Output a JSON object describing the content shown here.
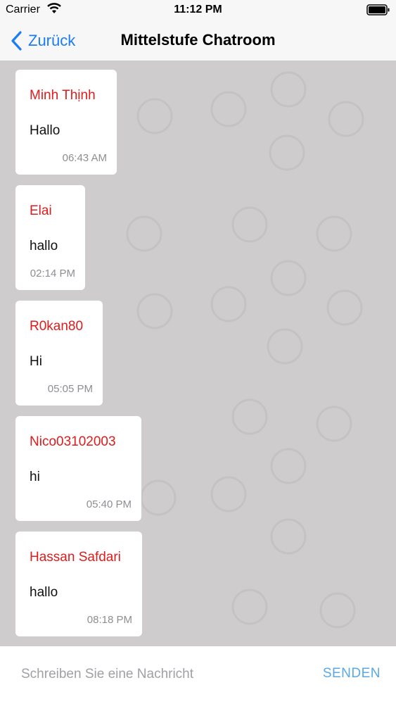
{
  "status_bar": {
    "carrier": "Carrier",
    "time": "11:12 PM",
    "wifi_icon": "wifi-icon",
    "battery_icon": "battery-icon"
  },
  "nav": {
    "back_label": "Zurück",
    "title": "Mittelstufe Chatroom",
    "accent_color": "#1a7cf6"
  },
  "messages": [
    {
      "sender": "Minh Thịnh",
      "text": "Hallo",
      "time": "06:43 AM"
    },
    {
      "sender": "Elai",
      "text": "hallo",
      "time": "02:14 PM"
    },
    {
      "sender": "R0kan80",
      "text": "Hi",
      "time": "05:05 PM"
    },
    {
      "sender": "Nico03102003",
      "text": "hi",
      "time": "05:40 PM"
    },
    {
      "sender": "Hassan Safdari",
      "text": "hallo",
      "time": "08:18 PM"
    }
  ],
  "colors": {
    "sender_name": "#e01b1b",
    "chat_background": "#cecccc",
    "send_button": "#5aa9e6"
  },
  "composer": {
    "value": "",
    "placeholder": "Schreiben Sie eine Nachricht",
    "send_label": "SENDEN"
  }
}
